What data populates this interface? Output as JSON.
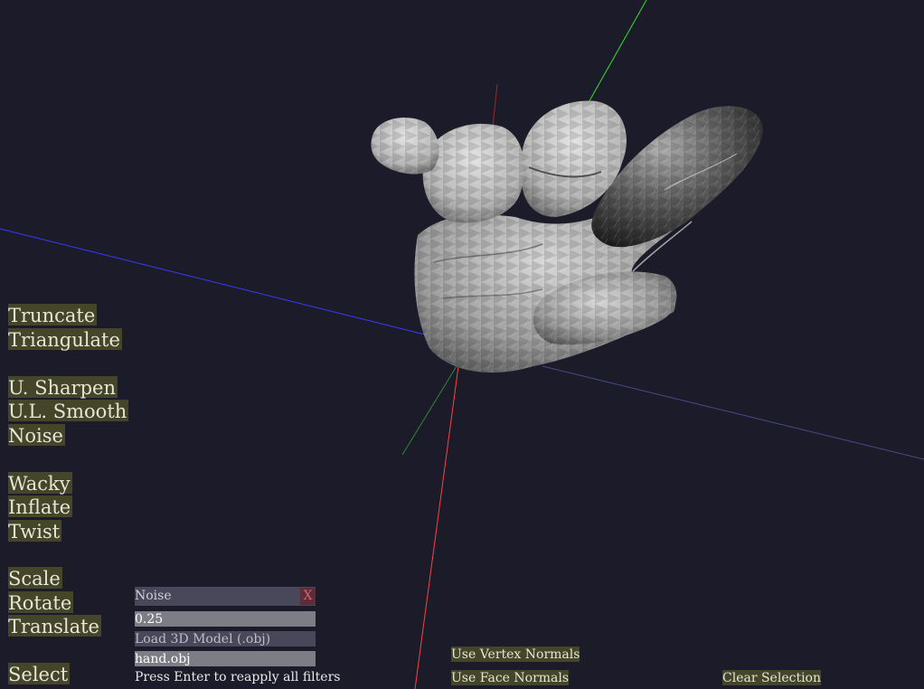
{
  "filters": {
    "truncate": "Truncate",
    "triangulate": "Triangulate",
    "u_sharpen": "U. Sharpen",
    "ul_smooth": "U.L. Smooth",
    "noise": "Noise",
    "wacky": "Wacky",
    "inflate": "Inflate",
    "twist": "Twist",
    "scale": "Scale",
    "rotate": "Rotate",
    "translate": "Translate",
    "select": "Select"
  },
  "panel": {
    "title": "Noise",
    "close_label": "X",
    "amount_value": "0.25",
    "load_label": "Load 3D Model (.obj)",
    "file_value": "hand.obj",
    "note": "Press Enter to reapply all filters"
  },
  "bottom_buttons": {
    "vertex_normals": "Use Vertex Normals",
    "face_normals": "Use Face Normals",
    "clear_selection": "Clear Selection"
  },
  "colors": {
    "background": "#1b1b29",
    "button_bg": "#45452a",
    "axis_x": "#ff4040",
    "axis_y": "#30e030",
    "axis_z": "#3a3aff"
  }
}
